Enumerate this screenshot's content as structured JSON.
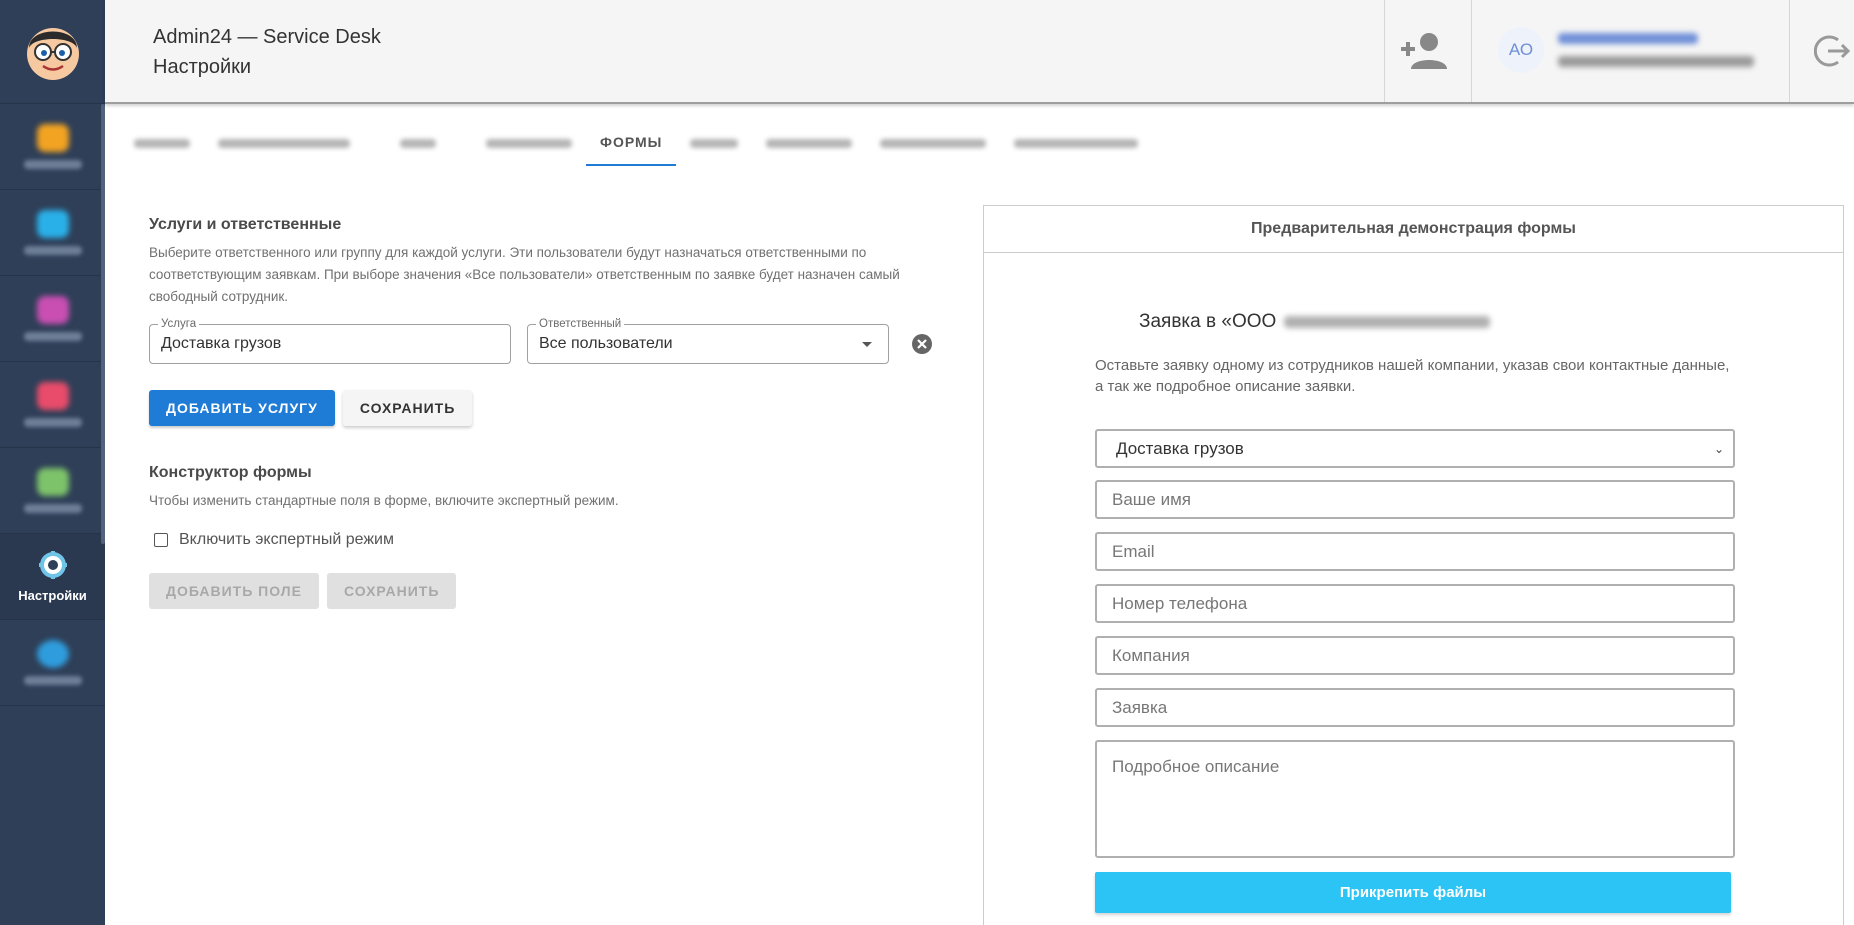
{
  "header": {
    "app_title": "Admin24 — Service Desk",
    "page_title": "Настройки",
    "avatar_initials": "АО"
  },
  "sidebar": {
    "active_item_label": "Настройки",
    "icon_colors": [
      "#f2a321",
      "#2ab0e8",
      "#c94fb3",
      "#e84c6a",
      "#7dc36a",
      "#6fc4e8",
      "#2f9ddd"
    ]
  },
  "tabs": {
    "active_label": "ФОРМЫ"
  },
  "services": {
    "title": "Услуги и ответственные",
    "description": "Выберите ответственного или группу для каждой услуги. Эти пользователи будут назначаться ответственными по соответствующим заявкам. При выборе значения «Все пользователи» ответственным по заявке будет назначен самый свободный сотрудник.",
    "service_label": "Услуга",
    "service_value": "Доставка грузов",
    "responsible_label": "Ответственный",
    "responsible_value": "Все пользователи",
    "add_button": "ДОБАВИТЬ УСЛУГУ",
    "save_button": "СОХРАНИТЬ"
  },
  "constructor": {
    "title": "Конструктор формы",
    "description": "Чтобы изменить стандартные поля в форме, включите экспертный режим.",
    "expert_mode_label": "Включить экспертный режим",
    "expert_mode_checked": false,
    "add_field_button": "ДОБАВИТЬ ПОЛЕ",
    "save_button": "СОХРАНИТЬ"
  },
  "preview": {
    "header": "Предварительная демонстрация формы",
    "form_title_prefix": "Заявка в «ООО",
    "description": "Оставьте заявку одному из сотрудников нашей компании, указав свои контактные данные, а так же подробное описание заявки.",
    "service_select_value": "Доставка грузов",
    "name_placeholder": "Ваше имя",
    "email_placeholder": "Email",
    "phone_placeholder": "Номер телефона",
    "company_placeholder": "Компания",
    "request_placeholder": "Заявка",
    "details_placeholder": "Подробное описание",
    "attach_button": "Прикрепить файлы"
  },
  "colors": {
    "sidebar_bg": "#2f3f58",
    "primary": "#1e7bd6",
    "attach_button": "#2bc4f4"
  }
}
